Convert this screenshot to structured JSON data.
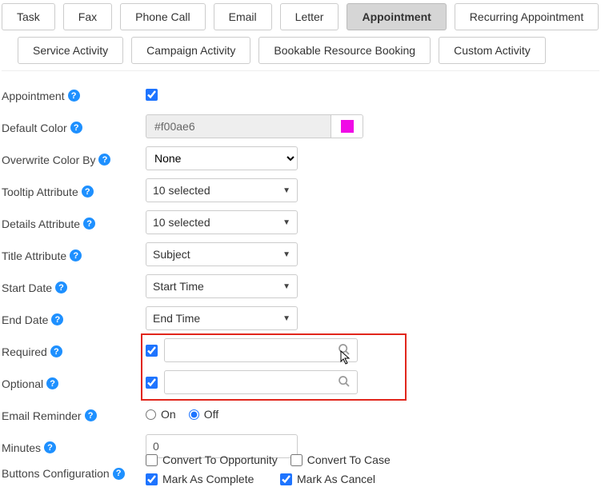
{
  "tabs_row1": [
    {
      "label": "Task",
      "active": false
    },
    {
      "label": "Fax",
      "active": false
    },
    {
      "label": "Phone Call",
      "active": false
    },
    {
      "label": "Email",
      "active": false
    },
    {
      "label": "Letter",
      "active": false
    },
    {
      "label": "Appointment",
      "active": true
    },
    {
      "label": "Recurring Appointment",
      "active": false
    }
  ],
  "tabs_row2": [
    {
      "label": "Service Activity"
    },
    {
      "label": "Campaign Activity"
    },
    {
      "label": "Bookable Resource Booking"
    },
    {
      "label": "Custom Activity"
    }
  ],
  "labels": {
    "appointment": "Appointment",
    "default_color": "Default Color",
    "overwrite_color_by": "Overwrite Color By",
    "tooltip_attribute": "Tooltip Attribute",
    "details_attribute": "Details Attribute",
    "title_attribute": "Title Attribute",
    "start_date": "Start Date",
    "end_date": "End Date",
    "required": "Required",
    "optional": "Optional",
    "email_reminder": "Email Reminder",
    "minutes": "Minutes",
    "buttons_configuration": "Buttons Configuration"
  },
  "values": {
    "appointment_checked": true,
    "default_color_hex": "#f00ae6",
    "overwrite_color_by": "None",
    "tooltip_attribute": "10 selected",
    "details_attribute": "10 selected",
    "title_attribute": "Subject",
    "start_date": "Start Time",
    "end_date": "End Time",
    "required_checked": true,
    "optional_checked": true,
    "email_reminder_on": "On",
    "email_reminder_off": "Off",
    "email_reminder_selected": "off",
    "minutes": "0",
    "convert_to_opportunity": "Convert To Opportunity",
    "convert_to_case": "Convert To Case",
    "mark_as_complete": "Mark As Complete",
    "mark_as_cancel": "Mark As Cancel",
    "convert_to_opportunity_checked": false,
    "convert_to_case_checked": false,
    "mark_as_complete_checked": true,
    "mark_as_cancel_checked": true
  }
}
